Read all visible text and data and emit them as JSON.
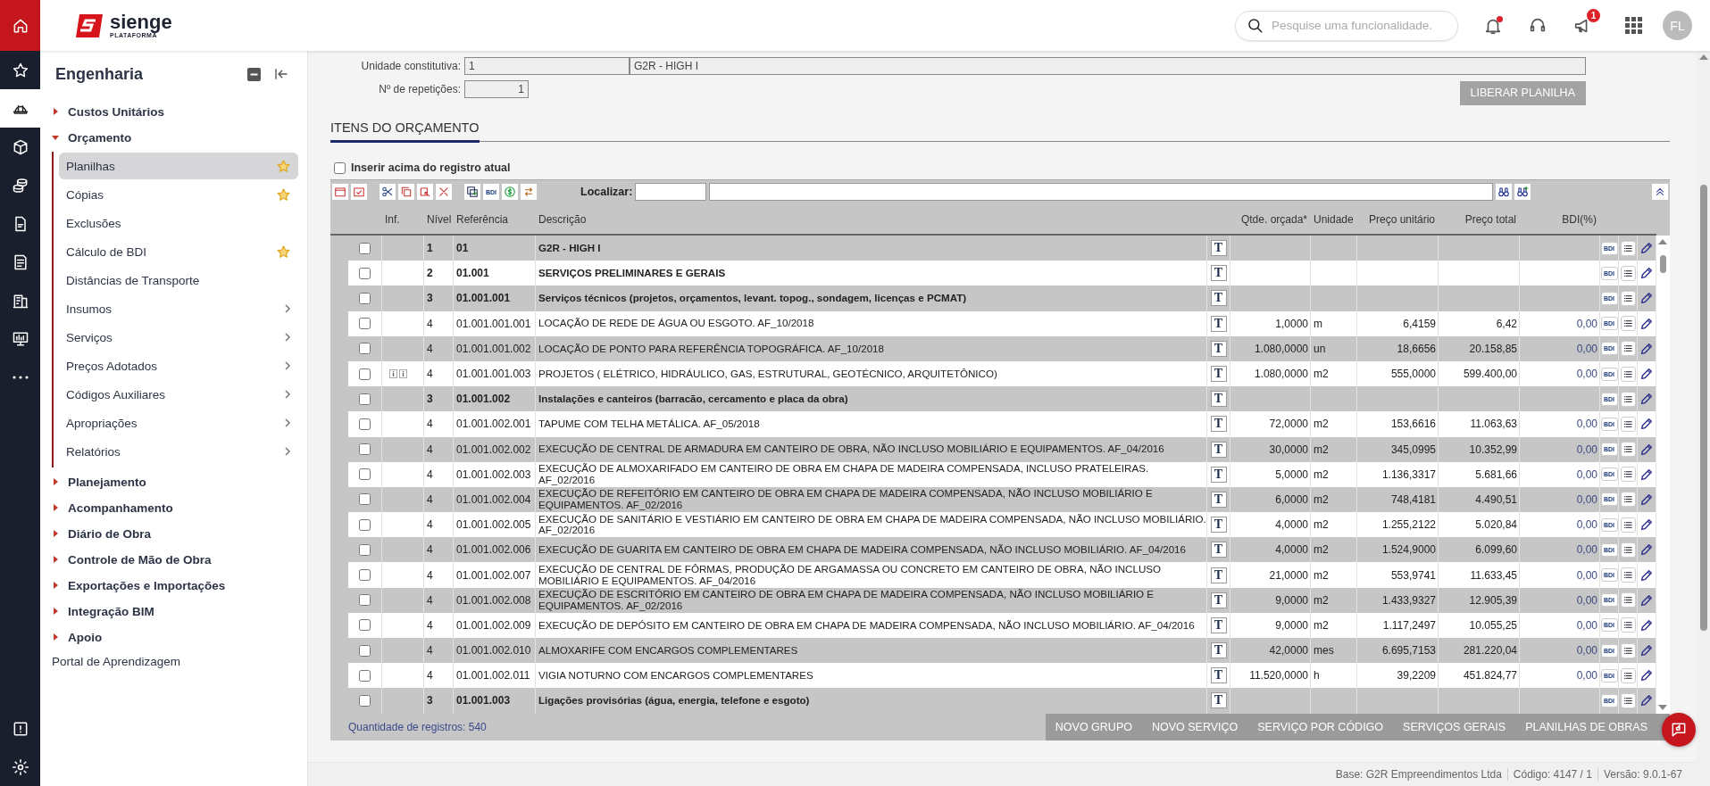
{
  "rail": [
    {
      "selected": false
    },
    {
      "selected": false
    },
    {
      "selected": true
    },
    {
      "selected": false
    },
    {
      "selected": false
    },
    {
      "selected": false
    },
    {
      "selected": false
    },
    {
      "selected": false
    },
    {
      "selected": false
    },
    {
      "selected": false
    }
  ],
  "header": {
    "logo": "sienge",
    "logo_sub": "PLATAFORMA",
    "search": {
      "placeholder": "Pesquise uma funcionalidade."
    },
    "notification_dot": true,
    "announcement_badge": "1",
    "avatar": "FL"
  },
  "sidebar": {
    "title": "Engenharia",
    "items": [
      {
        "kind": "section",
        "label": "Custos Unitários",
        "expanded": false
      },
      {
        "kind": "section",
        "label": "Orçamento",
        "expanded": true,
        "children": [
          {
            "label": "Planilhas",
            "selected": true,
            "favorite": true,
            "submenu": false
          },
          {
            "label": "Cópias",
            "selected": false,
            "favorite": true,
            "submenu": false
          },
          {
            "label": "Exclusões",
            "selected": false,
            "favorite": false,
            "submenu": false
          },
          {
            "label": "Cálculo de BDI",
            "selected": false,
            "favorite": true,
            "submenu": false
          },
          {
            "label": "Distâncias de Transporte",
            "selected": false,
            "favorite": false,
            "submenu": false
          },
          {
            "label": "Insumos",
            "selected": false,
            "favorite": false,
            "submenu": true
          },
          {
            "label": "Serviços",
            "selected": false,
            "favorite": false,
            "submenu": true
          },
          {
            "label": "Preços Adotados",
            "selected": false,
            "favorite": false,
            "submenu": true
          },
          {
            "label": "Códigos Auxiliares",
            "selected": false,
            "favorite": false,
            "submenu": true
          },
          {
            "label": "Apropriações",
            "selected": false,
            "favorite": false,
            "submenu": true
          },
          {
            "label": "Relatórios",
            "selected": false,
            "favorite": false,
            "submenu": true
          }
        ]
      },
      {
        "kind": "section",
        "label": "Planejamento",
        "expanded": false
      },
      {
        "kind": "section",
        "label": "Acompanhamento",
        "expanded": false
      },
      {
        "kind": "section",
        "label": "Diário de Obra",
        "expanded": false
      },
      {
        "kind": "section",
        "label": "Controle de Mão de Obra",
        "expanded": false
      },
      {
        "kind": "section",
        "label": "Exportações e Importações",
        "expanded": false
      },
      {
        "kind": "section",
        "label": "Integração BIM",
        "expanded": false
      },
      {
        "kind": "section",
        "label": "Apoio",
        "expanded": false
      },
      {
        "kind": "link",
        "label": "Portal de Aprendizagem"
      }
    ]
  },
  "form": {
    "unit_label": "Unidade constitutiva:",
    "unit_code": "1",
    "unit_name": "G2R - HIGH I",
    "repetitions_label": "Nº de repetições:",
    "repetitions": "1",
    "release_button": "LIBERAR PLANILHA"
  },
  "section_tab": "ITENS DO ORÇAMENTO",
  "insert_above": {
    "label": "Inserir acima do registro atual",
    "checked": false
  },
  "grid_toolbar": {
    "bdi_button": "BDI",
    "search_label": "Localizar:"
  },
  "table": {
    "columns": [
      "Inf.",
      "Nível",
      "Referência",
      "Descrição",
      "Qtde. orçada*",
      "Unidade",
      "Preço unitário",
      "Preço total",
      "BDI(%)"
    ],
    "rows": [
      {
        "kind": "group",
        "checked": false,
        "info": false,
        "level": "1",
        "reference": "01",
        "description": "G2R - HIGH I",
        "text_button": "T",
        "bdi_button": "BDI"
      },
      {
        "kind": "group",
        "checked": false,
        "info": false,
        "level": "2",
        "reference": "01.001",
        "description": "SERVIÇOS PRELIMINARES E GERAIS",
        "text_button": "T",
        "bdi_button": "BDI"
      },
      {
        "kind": "group",
        "checked": false,
        "info": false,
        "level": "3",
        "reference": "01.001.001",
        "description": "Serviços técnicos (projetos, orçamentos, levant. topog., sondagem, licenças e PCMAT)",
        "text_button": "T",
        "bdi_button": "BDI"
      },
      {
        "kind": "service",
        "checked": false,
        "info": false,
        "level": "4",
        "reference": "01.001.001.001",
        "description": "LOCAÇÃO DE REDE DE ÁGUA OU ESGOTO. AF_10/2018",
        "text_button": "T",
        "quantity": "1,0000",
        "unit": "m",
        "unit_price": "6,4159",
        "total_price": "6,42",
        "bdi": "0,00",
        "bdi_button": "BDI"
      },
      {
        "kind": "service",
        "checked": false,
        "info": false,
        "level": "4",
        "reference": "01.001.001.002",
        "description": "LOCAÇÃO DE PONTO PARA REFERÊNCIA TOPOGRÁFICA. AF_10/2018",
        "text_button": "T",
        "quantity": "1.080,0000",
        "unit": "un",
        "unit_price": "18,6656",
        "total_price": "20.158,85",
        "bdi": "0,00",
        "bdi_button": "BDI"
      },
      {
        "kind": "service",
        "checked": false,
        "info": true,
        "level": "4",
        "reference": "01.001.001.003",
        "description": "PROJETOS ( ELÉTRICO, HIDRÁULICO, GAS, ESTRUTURAL, GEOTÉCNICO, ARQUITETÔNICO)",
        "text_button": "T",
        "quantity": "1.080,0000",
        "unit": "m2",
        "unit_price": "555,0000",
        "total_price": "599.400,00",
        "bdi": "0,00",
        "bdi_button": "BDI"
      },
      {
        "kind": "group",
        "checked": false,
        "info": false,
        "level": "3",
        "reference": "01.001.002",
        "description": "Instalações e canteiros (barracão, cercamento e placa da obra)",
        "text_button": "T",
        "bdi_button": "BDI"
      },
      {
        "kind": "service",
        "checked": false,
        "info": false,
        "level": "4",
        "reference": "01.001.002.001",
        "description": "TAPUME COM TELHA METÁLICA. AF_05/2018",
        "text_button": "T",
        "quantity": "72,0000",
        "unit": "m2",
        "unit_price": "153,6616",
        "total_price": "11.063,63",
        "bdi": "0,00",
        "bdi_button": "BDI"
      },
      {
        "kind": "service",
        "checked": false,
        "info": false,
        "level": "4",
        "reference": "01.001.002.002",
        "description": "EXECUÇÃO DE CENTRAL DE ARMADURA EM CANTEIRO DE OBRA, NÃO INCLUSO MOBILIÁRIO E EQUIPAMENTOS. AF_04/2016",
        "text_button": "T",
        "quantity": "30,0000",
        "unit": "m2",
        "unit_price": "345,0995",
        "total_price": "10.352,99",
        "bdi": "0,00",
        "bdi_button": "BDI"
      },
      {
        "kind": "service",
        "checked": false,
        "info": false,
        "level": "4",
        "reference": "01.001.002.003",
        "description": "EXECUÇÃO DE ALMOXARIFADO EM CANTEIRO DE OBRA EM CHAPA DE MADEIRA COMPENSADA, INCLUSO PRATELEIRAS. AF_02/2016",
        "text_button": "T",
        "quantity": "5,0000",
        "unit": "m2",
        "unit_price": "1.136,3317",
        "total_price": "5.681,66",
        "bdi": "0,00",
        "bdi_button": "BDI"
      },
      {
        "kind": "service",
        "checked": false,
        "info": false,
        "level": "4",
        "reference": "01.001.002.004",
        "description": "EXECUÇÃO DE REFEITÓRIO EM CANTEIRO DE OBRA EM CHAPA DE MADEIRA COMPENSADA, NÃO INCLUSO MOBILIÁRIO E EQUIPAMENTOS. AF_02/2016",
        "text_button": "T",
        "quantity": "6,0000",
        "unit": "m2",
        "unit_price": "748,4181",
        "total_price": "4.490,51",
        "bdi": "0,00",
        "bdi_button": "BDI"
      },
      {
        "kind": "service",
        "checked": false,
        "info": false,
        "level": "4",
        "reference": "01.001.002.005",
        "description": "EXECUÇÃO DE SANITÁRIO E VESTIÁRIO EM CANTEIRO DE OBRA EM CHAPA DE MADEIRA COMPENSADA, NÃO INCLUSO MOBILIÁRIO. AF_02/2016",
        "text_button": "T",
        "quantity": "4,0000",
        "unit": "m2",
        "unit_price": "1.255,2122",
        "total_price": "5.020,84",
        "bdi": "0,00",
        "bdi_button": "BDI"
      },
      {
        "kind": "service",
        "checked": false,
        "info": false,
        "level": "4",
        "reference": "01.001.002.006",
        "description": "EXECUÇÃO DE GUARITA EM CANTEIRO DE OBRA EM CHAPA DE MADEIRA COMPENSADA, NÃO INCLUSO MOBILIÁRIO. AF_04/2016",
        "text_button": "T",
        "quantity": "4,0000",
        "unit": "m2",
        "unit_price": "1.524,9000",
        "total_price": "6.099,60",
        "bdi": "0,00",
        "bdi_button": "BDI"
      },
      {
        "kind": "service",
        "checked": false,
        "info": false,
        "level": "4",
        "reference": "01.001.002.007",
        "description": "EXECUÇÃO DE CENTRAL DE FÔRMAS, PRODUÇÃO DE ARGAMASSA OU CONCRETO EM CANTEIRO DE OBRA, NÃO INCLUSO MOBILIÁRIO E EQUIPAMENTOS. AF_04/2016",
        "text_button": "T",
        "quantity": "21,0000",
        "unit": "m2",
        "unit_price": "553,9741",
        "total_price": "11.633,45",
        "bdi": "0,00",
        "bdi_button": "BDI"
      },
      {
        "kind": "service",
        "checked": false,
        "info": false,
        "level": "4",
        "reference": "01.001.002.008",
        "description": "EXECUÇÃO DE ESCRITÓRIO EM CANTEIRO DE OBRA EM CHAPA DE MADEIRA COMPENSADA, NÃO INCLUSO MOBILIÁRIO E EQUIPAMENTOS. AF_02/2016",
        "text_button": "T",
        "quantity": "9,0000",
        "unit": "m2",
        "unit_price": "1.433,9327",
        "total_price": "12.905,39",
        "bdi": "0,00",
        "bdi_button": "BDI"
      },
      {
        "kind": "service",
        "checked": false,
        "info": false,
        "level": "4",
        "reference": "01.001.002.009",
        "description": "EXECUÇÃO DE DEPÓSITO EM CANTEIRO DE OBRA EM CHAPA DE MADEIRA COMPENSADA, NÃO INCLUSO MOBILIÁRIO. AF_04/2016",
        "text_button": "T",
        "quantity": "9,0000",
        "unit": "m2",
        "unit_price": "1.117,2497",
        "total_price": "10.055,25",
        "bdi": "0,00",
        "bdi_button": "BDI"
      },
      {
        "kind": "service",
        "checked": false,
        "info": false,
        "level": "4",
        "reference": "01.001.002.010",
        "description": "ALMOXARIFE COM ENCARGOS COMPLEMENTARES",
        "text_button": "T",
        "quantity": "42,0000",
        "unit": "mes",
        "unit_price": "6.695,7153",
        "total_price": "281.220,04",
        "bdi": "0,00",
        "bdi_button": "BDI"
      },
      {
        "kind": "service",
        "checked": false,
        "info": false,
        "level": "4",
        "reference": "01.001.002.011",
        "description": "VIGIA NOTURNO COM ENCARGOS COMPLEMENTARES",
        "text_button": "T",
        "quantity": "11.520,0000",
        "unit": "h",
        "unit_price": "39,2209",
        "total_price": "451.824,77",
        "bdi": "0,00",
        "bdi_button": "BDI"
      },
      {
        "kind": "group",
        "checked": false,
        "info": false,
        "level": "3",
        "reference": "01.001.003",
        "description": "Ligações provisórias (água, energia, telefone e esgoto)",
        "text_button": "T",
        "bdi_button": "BDI"
      }
    ]
  },
  "table_footer": {
    "record_count": "Quantidade de registros: 540",
    "buttons": [
      "NOVO GRUPO",
      "NOVO SERVIÇO",
      "SERVIÇO POR CÓDIGO",
      "SERVIÇOS GERAIS",
      "PLANILHAS DE OBRAS"
    ]
  },
  "status_bar": [
    "Base: G2R Empreendimentos Ltda",
    "Código: 4147 / 1",
    "Versão: 9.0.1-67"
  ]
}
